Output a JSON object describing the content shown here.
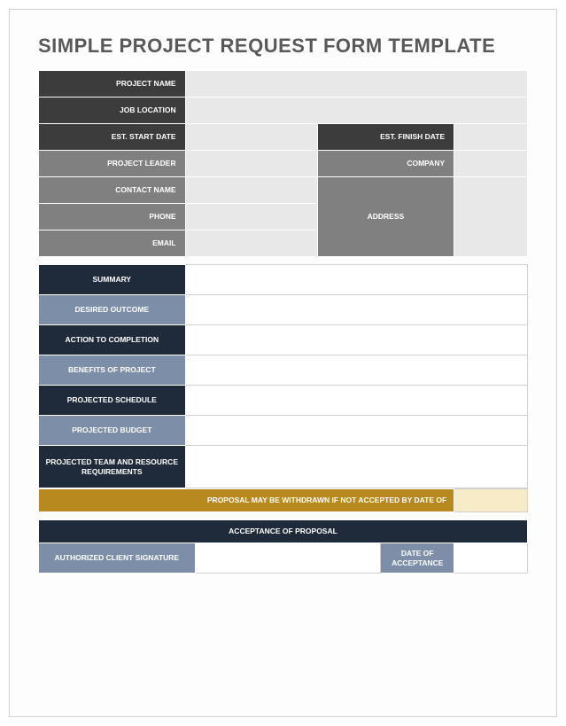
{
  "title": "SIMPLE PROJECT REQUEST FORM TEMPLATE",
  "sec1": {
    "project_name": "PROJECT NAME",
    "job_location": "JOB LOCATION",
    "est_start": "EST. START DATE",
    "est_finish": "EST. FINISH DATE",
    "leader": "PROJECT LEADER",
    "company": "COMPANY",
    "contact": "CONTACT NAME",
    "phone": "PHONE",
    "email": "EMAIL",
    "address": "ADDRESS"
  },
  "sec2": {
    "summary": "SUMMARY",
    "outcome": "DESIRED OUTCOME",
    "action": "ACTION TO COMPLETION",
    "benefits": "BENEFITS OF PROJECT",
    "schedule": "PROJECTED SCHEDULE",
    "budget": "PROJECTED BUDGET",
    "team": "PROJECTED TEAM AND RESOURCE REQUIREMENTS"
  },
  "sec3": {
    "withdraw": "PROPOSAL MAY BE WITHDRAWN IF NOT ACCEPTED BY DATE OF"
  },
  "sec4": {
    "header": "ACCEPTANCE OF PROPOSAL",
    "signature": "AUTHORIZED CLIENT SIGNATURE",
    "date": "DATE OF ACCEPTANCE"
  }
}
